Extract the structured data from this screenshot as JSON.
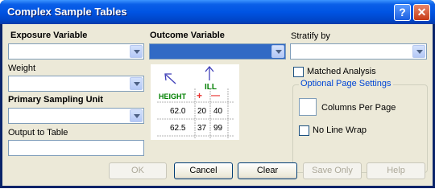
{
  "window": {
    "title": "Complex Sample Tables",
    "help_label": "?",
    "close_label": "✕"
  },
  "fields": {
    "exposure": {
      "label": "Exposure Variable",
      "value": ""
    },
    "outcome": {
      "label": "Outcome Variable",
      "value": ""
    },
    "stratify": {
      "label": "Stratify by",
      "value": ""
    },
    "weight": {
      "label": "Weight",
      "value": ""
    },
    "psu": {
      "label": "Primary Sampling Unit",
      "value": ""
    },
    "output": {
      "label": "Output to Table",
      "value": ""
    }
  },
  "options": {
    "matched_analysis": {
      "label": "Matched Analysis",
      "checked": false
    },
    "page_settings_title": "Optional Page Settings",
    "columns_per_page": {
      "label": "Columns Per Page",
      "value": ""
    },
    "no_line_wrap": {
      "label": "No Line Wrap",
      "checked": false
    }
  },
  "illustration": {
    "col_header": "ILL",
    "row_header": "HEIGHT",
    "plus": "+",
    "minus": "—",
    "rows": [
      {
        "label": "62.0",
        "cells": [
          "20",
          "40"
        ]
      },
      {
        "label": "62.5",
        "cells": [
          "37",
          "99"
        ]
      }
    ]
  },
  "buttons": {
    "ok": "OK",
    "cancel": "Cancel",
    "clear": "Clear",
    "save_only": "Save Only",
    "help": "Help"
  },
  "colors": {
    "title_bar": "#0054e3",
    "selection": "#316ac5",
    "red": "#e8312e",
    "green": "#008000",
    "blue": "#3f3fb8"
  }
}
